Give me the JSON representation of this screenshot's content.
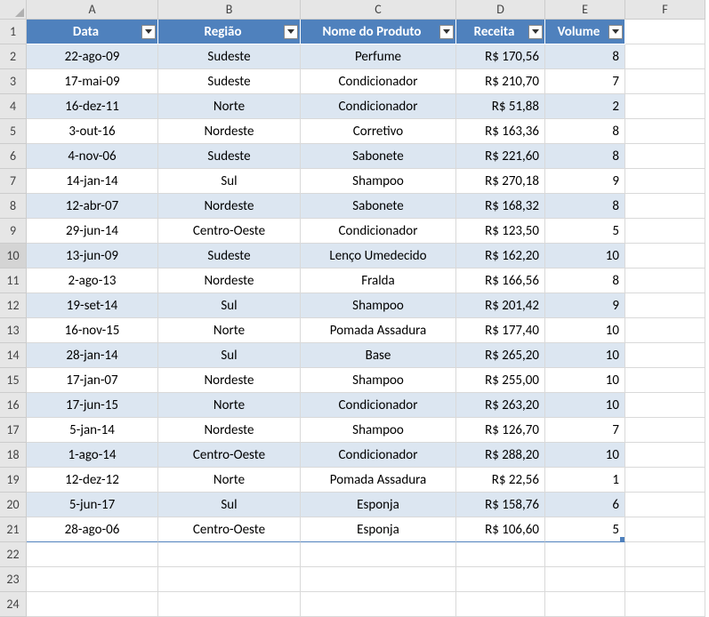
{
  "columns": [
    "A",
    "B",
    "C",
    "D",
    "E",
    "F"
  ],
  "rowCount": 24,
  "selectedRow": 10,
  "headers": [
    {
      "label": "Data",
      "bind": "headers.0.label"
    },
    {
      "label": "Região",
      "bind": "headers.1.label"
    },
    {
      "label": "Nome do Produto",
      "bind": "headers.2.label"
    },
    {
      "label": "Receita",
      "bind": "headers.3.label"
    },
    {
      "label": "Volume",
      "bind": "headers.4.label"
    }
  ],
  "rows": [
    {
      "data": "22-ago-09",
      "regiao": "Sudeste",
      "produto": "Perfume",
      "receita": "R$ 170,56",
      "volume": "8"
    },
    {
      "data": "17-mai-09",
      "regiao": "Sudeste",
      "produto": "Condicionador",
      "receita": "R$ 210,70",
      "volume": "7"
    },
    {
      "data": "16-dez-11",
      "regiao": "Norte",
      "produto": "Condicionador",
      "receita": "R$ 51,88",
      "volume": "2"
    },
    {
      "data": "3-out-16",
      "regiao": "Nordeste",
      "produto": "Corretivo",
      "receita": "R$ 163,36",
      "volume": "8"
    },
    {
      "data": "4-nov-06",
      "regiao": "Sudeste",
      "produto": "Sabonete",
      "receita": "R$ 221,60",
      "volume": "8"
    },
    {
      "data": "14-jan-14",
      "regiao": "Sul",
      "produto": "Shampoo",
      "receita": "R$ 270,18",
      "volume": "9"
    },
    {
      "data": "12-abr-07",
      "regiao": "Nordeste",
      "produto": "Sabonete",
      "receita": "R$ 168,32",
      "volume": "8"
    },
    {
      "data": "29-jun-14",
      "regiao": "Centro-Oeste",
      "produto": "Condicionador",
      "receita": "R$ 123,50",
      "volume": "5"
    },
    {
      "data": "13-jun-09",
      "regiao": "Sudeste",
      "produto": "Lenço Umedecido",
      "receita": "R$ 162,20",
      "volume": "10"
    },
    {
      "data": "2-ago-13",
      "regiao": "Nordeste",
      "produto": "Fralda",
      "receita": "R$ 166,56",
      "volume": "8"
    },
    {
      "data": "19-set-14",
      "regiao": "Sul",
      "produto": "Shampoo",
      "receita": "R$ 201,42",
      "volume": "9"
    },
    {
      "data": "16-nov-15",
      "regiao": "Norte",
      "produto": "Pomada Assadura",
      "receita": "R$ 177,40",
      "volume": "10"
    },
    {
      "data": "28-jan-14",
      "regiao": "Sul",
      "produto": "Base",
      "receita": "R$ 265,20",
      "volume": "10"
    },
    {
      "data": "17-jan-07",
      "regiao": "Nordeste",
      "produto": "Shampoo",
      "receita": "R$ 255,00",
      "volume": "10"
    },
    {
      "data": "17-jun-15",
      "regiao": "Norte",
      "produto": "Condicionador",
      "receita": "R$ 263,20",
      "volume": "10"
    },
    {
      "data": "5-jan-14",
      "regiao": "Nordeste",
      "produto": "Shampoo",
      "receita": "R$ 126,70",
      "volume": "7"
    },
    {
      "data": "1-ago-14",
      "regiao": "Centro-Oeste",
      "produto": "Condicionador",
      "receita": "R$ 288,20",
      "volume": "10"
    },
    {
      "data": "12-dez-12",
      "regiao": "Norte",
      "produto": "Pomada Assadura",
      "receita": "R$ 22,56",
      "volume": "1"
    },
    {
      "data": "5-jun-17",
      "regiao": "Sul",
      "produto": "Esponja",
      "receita": "R$ 158,76",
      "volume": "6"
    },
    {
      "data": "28-ago-06",
      "regiao": "Centro-Oeste",
      "produto": "Esponja",
      "receita": "R$ 106,60",
      "volume": "5"
    }
  ]
}
